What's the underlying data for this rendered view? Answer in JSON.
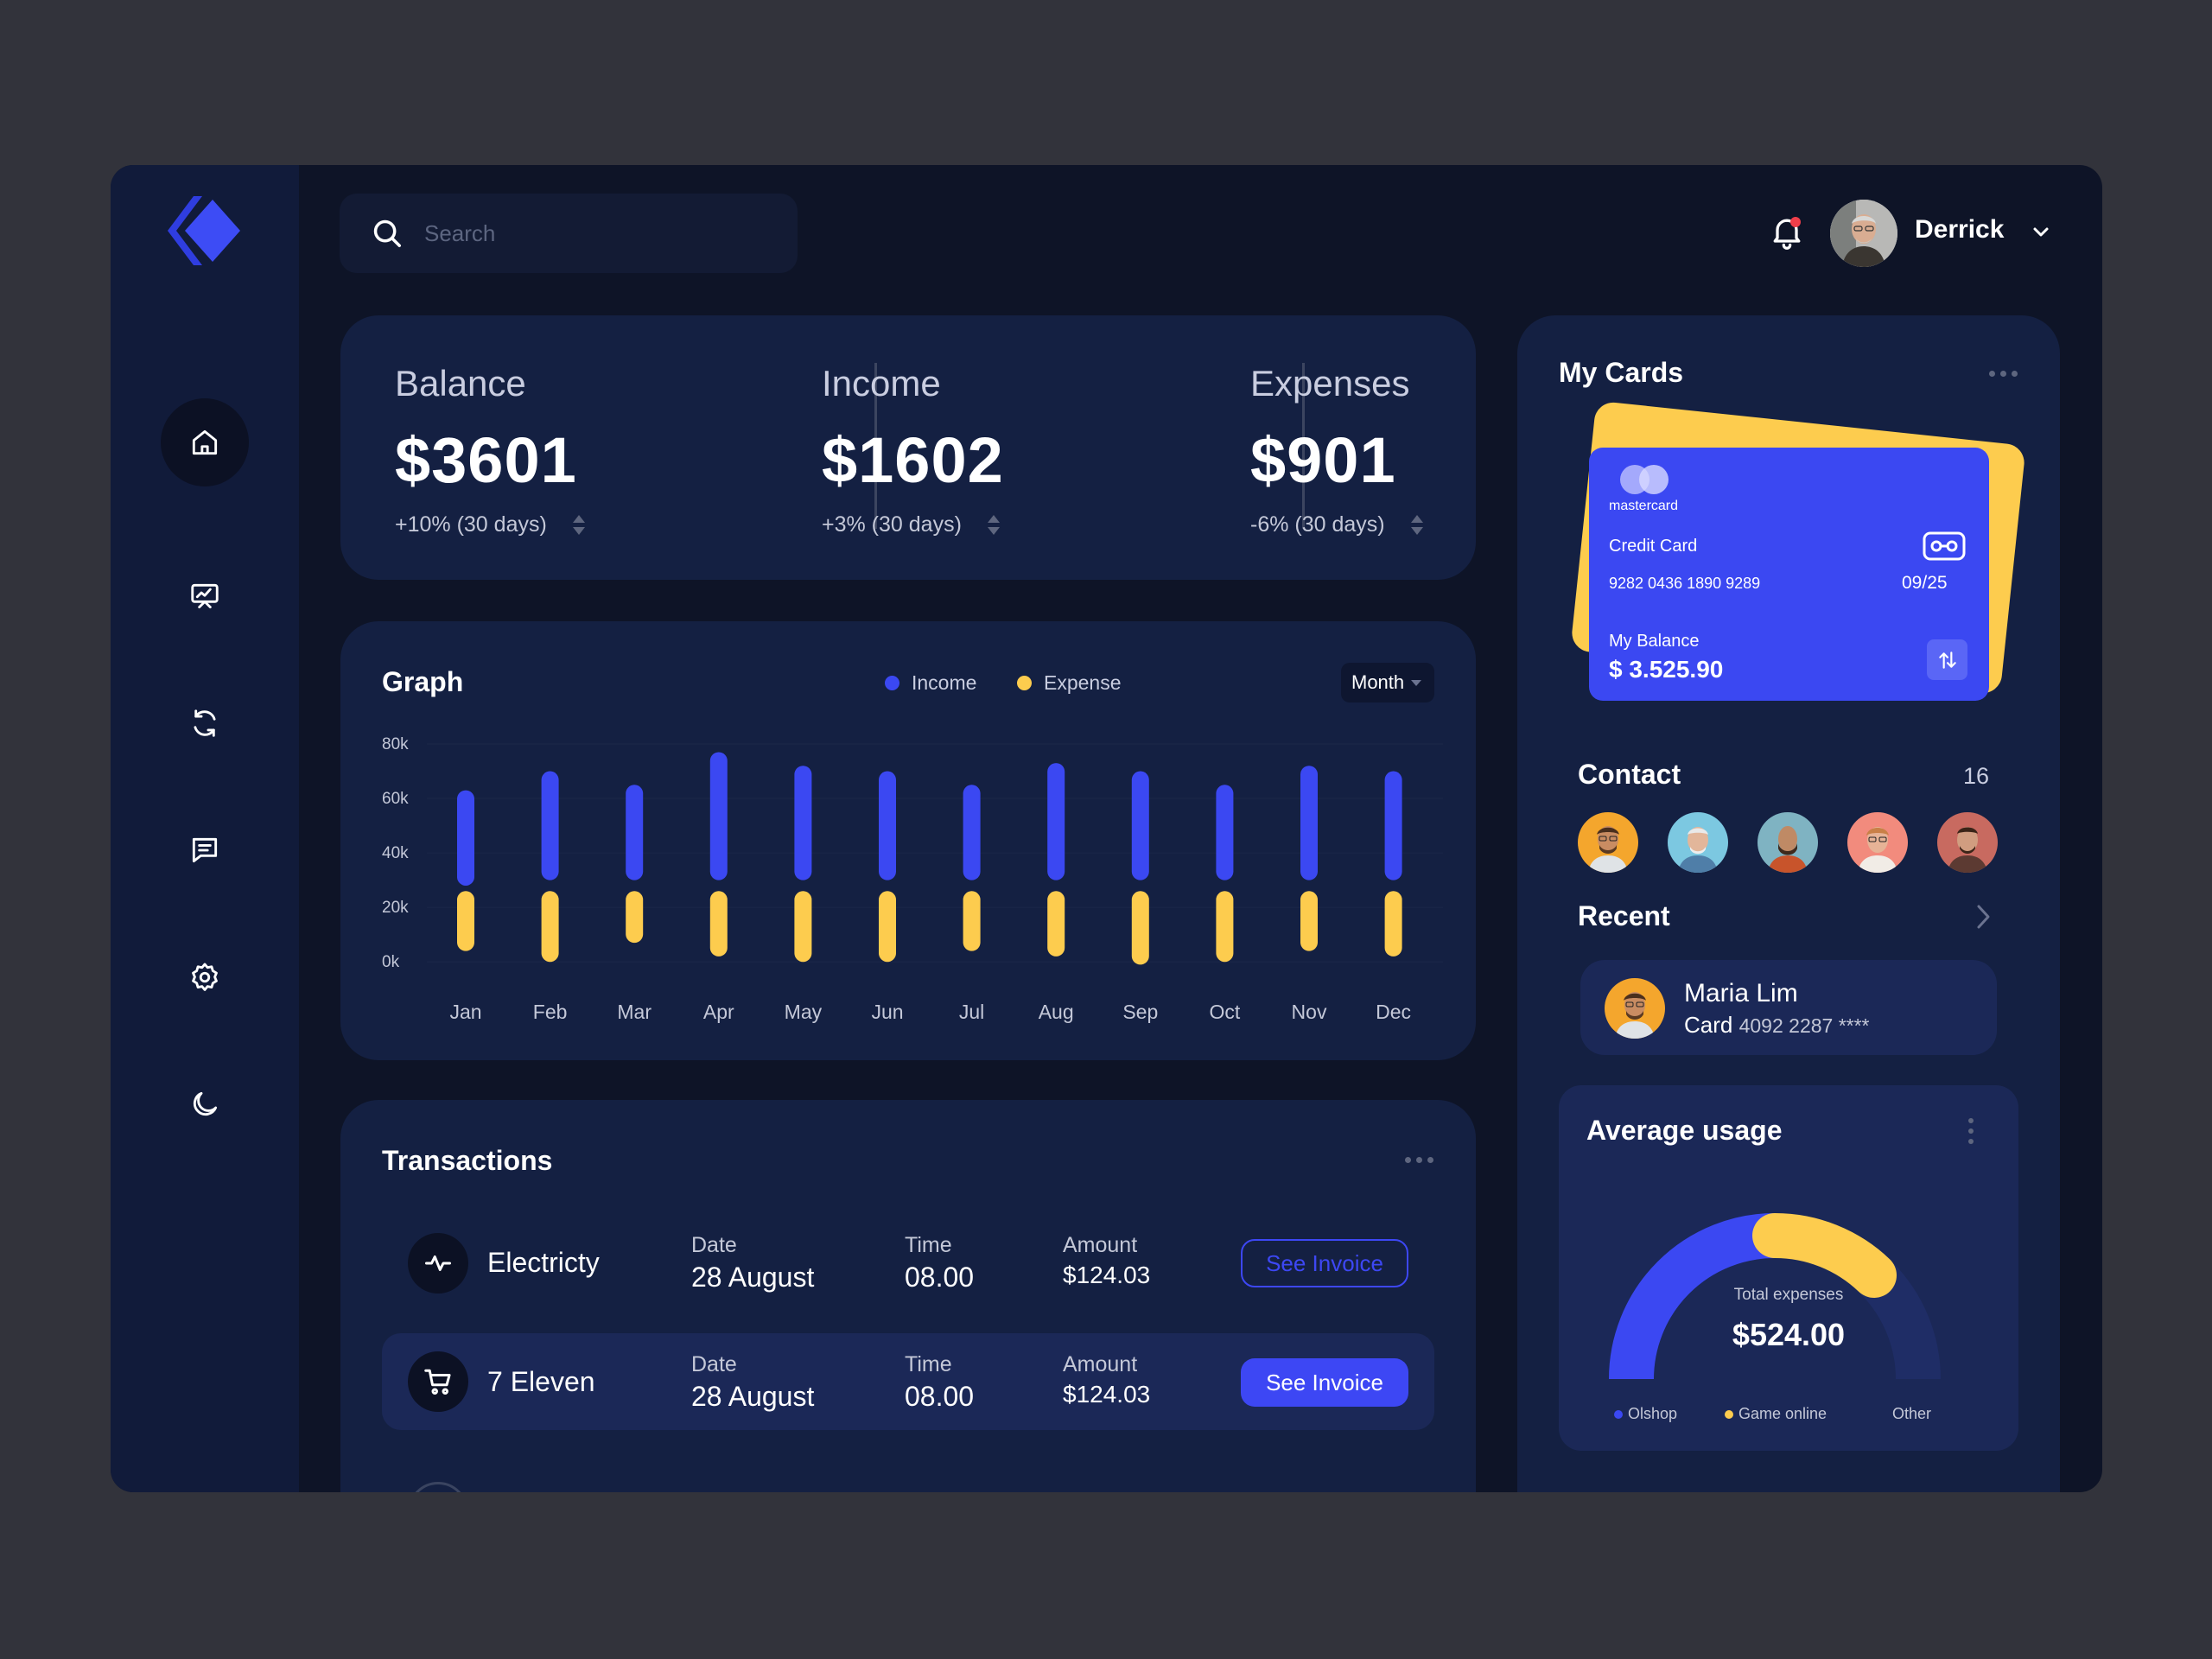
{
  "search": {
    "placeholder": "Search"
  },
  "user": {
    "name": "Derrick"
  },
  "stats": [
    {
      "label": "Balance",
      "value": "$3601",
      "change": "+10% (30 days)"
    },
    {
      "label": "Income",
      "value": "$1602",
      "change": "+3% (30 days)"
    },
    {
      "label": "Expenses",
      "value": "$901",
      "change": "-6% (30 days)"
    }
  ],
  "graph": {
    "title": "Graph",
    "legend_income": "Income",
    "legend_expense": "Expense",
    "period": "Month"
  },
  "chart_data": {
    "type": "bar",
    "title": "Graph",
    "categories": [
      "Jan",
      "Feb",
      "Mar",
      "Apr",
      "May",
      "Jun",
      "Jul",
      "Aug",
      "Sep",
      "Oct",
      "Nov",
      "Dec"
    ],
    "series": [
      {
        "name": "Income",
        "color": "#3b48f2",
        "range": [
          [
            28,
            63
          ],
          [
            30,
            70
          ],
          [
            30,
            65
          ],
          [
            30,
            77
          ],
          [
            30,
            72
          ],
          [
            30,
            70
          ],
          [
            30,
            65
          ],
          [
            30,
            73
          ],
          [
            30,
            70
          ],
          [
            30,
            65
          ],
          [
            30,
            72
          ],
          [
            30,
            70
          ]
        ]
      },
      {
        "name": "Expense",
        "color": "#fdcc4e",
        "range": [
          [
            4,
            26
          ],
          [
            0,
            26
          ],
          [
            7,
            26
          ],
          [
            2,
            26
          ],
          [
            0,
            26
          ],
          [
            0,
            26
          ],
          [
            4,
            26
          ],
          [
            2,
            26
          ],
          [
            -1,
            26
          ],
          [
            0,
            26
          ],
          [
            4,
            26
          ],
          [
            2,
            26
          ]
        ]
      }
    ],
    "yticks": [
      "80k",
      "60k",
      "40k",
      "20k",
      "0k"
    ],
    "ylim": [
      0,
      80
    ]
  },
  "transactions": {
    "title": "Transactions",
    "rows": [
      {
        "name": "Electricty",
        "date_label": "Date",
        "date": "28 August",
        "time_label": "Time",
        "time": "08.00",
        "amount_label": "Amount",
        "amount": "$124.03",
        "button": "See Invoice"
      },
      {
        "name": "7 Eleven",
        "date_label": "Date",
        "date": "28 August",
        "time_label": "Time",
        "time": "08.00",
        "amount_label": "Amount",
        "amount": "$124.03",
        "button": "See Invoice"
      }
    ]
  },
  "my_cards": {
    "title": "My Cards",
    "brand": "mastercard",
    "type": "Credit Card",
    "number": "9282 0436 1890 9289",
    "expiry": "09/25",
    "balance_label": "My Balance",
    "balance": "$ 3.525.90"
  },
  "contact": {
    "title": "Contact",
    "count": "16"
  },
  "recent": {
    "title": "Recent",
    "name": "Maria Lim",
    "card_label": "Card",
    "card_number": "4092 2287 ****"
  },
  "usage": {
    "title": "Average usage",
    "total_label": "Total expenses",
    "total": "$524.00",
    "legend": [
      "Olshop",
      "Game online",
      "Other"
    ],
    "share": {
      "olshop": 0.6,
      "game_online": 0.18,
      "other": 0.22
    }
  }
}
